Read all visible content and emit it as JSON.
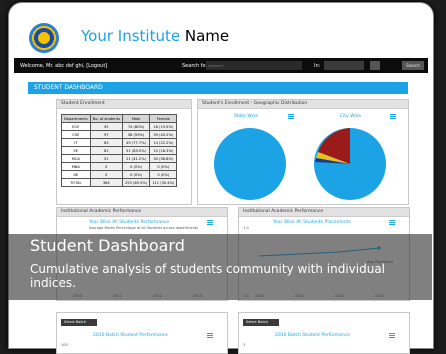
{
  "header": {
    "brand_part1": "Your Institute",
    "brand_part2": " Name"
  },
  "navbar": {
    "welcome": "Welcome, Mr. abc def ghi, [Logout]",
    "search_label": "Search for:",
    "search_placeholder": "keyword",
    "in_label": "In:",
    "search_button": "Search"
  },
  "banner": {
    "title": "STUDENT DASHBOARD"
  },
  "enrollment": {
    "title": "Student Enrollment",
    "headers": [
      "Departments",
      "No. of students",
      "Male",
      "Female"
    ],
    "rows": [
      [
        "ECE",
        "92",
        "74 (80%)",
        "18 (19.5%)"
      ],
      [
        "CSE",
        "97",
        "58 (59%)",
        "39 (40.2%)"
      ],
      [
        "IT",
        "63",
        "49 (77.7%)",
        "14 (22.2%)"
      ],
      [
        "EE",
        "61",
        "51 (83.5%)",
        "10 (16.3%)"
      ],
      [
        "MCA",
        "51",
        "21 (41.2%)",
        "30 (58.8%)"
      ],
      [
        "MBA",
        "0",
        "0 (0%)",
        "0 (0%)"
      ],
      [
        "AE",
        "0",
        "0 (0%)",
        "0 (0%)"
      ],
      [
        "TOTAL",
        "364",
        "253 (69.5%)",
        "111 (30.4%)"
      ]
    ]
  },
  "geo": {
    "title": "Student's Enrollment - Geographic Distribution",
    "left_label": "State Wise",
    "right_label": "City Wise"
  },
  "academic": {
    "title": "Institutional Academic Performance",
    "chart_title": "Year Wise All Students Performance",
    "chart_subtitle": "Average Marks Percentage of all Students across departments",
    "years": [
      "2010",
      "2011",
      "2012",
      "2013"
    ]
  },
  "placements": {
    "title": "Institutional Academic Performance",
    "chart_title": "Year Wise All Students Placements",
    "y_top": "1.0",
    "y_bottom": "1.0",
    "legend": "Avg Placement",
    "years": [
      "2010",
      "2011",
      "2012",
      "2013"
    ]
  },
  "batch_left": {
    "select_label": "Select Batch",
    "chart_title": "2010 Batch Student Performance",
    "y_top": "100"
  },
  "batch_right": {
    "select_label": "Select Batch",
    "chart_title": "2010 Batch Student Performance",
    "y_top": "3"
  },
  "overlay": {
    "title": "Student Dashboard",
    "description": "Cumulative analysis of students community with individual indices."
  },
  "colors": {
    "accent": "#1ca3e6",
    "pie_dark_red": "#9b1a1a",
    "navbar": "#0c0c0c"
  }
}
